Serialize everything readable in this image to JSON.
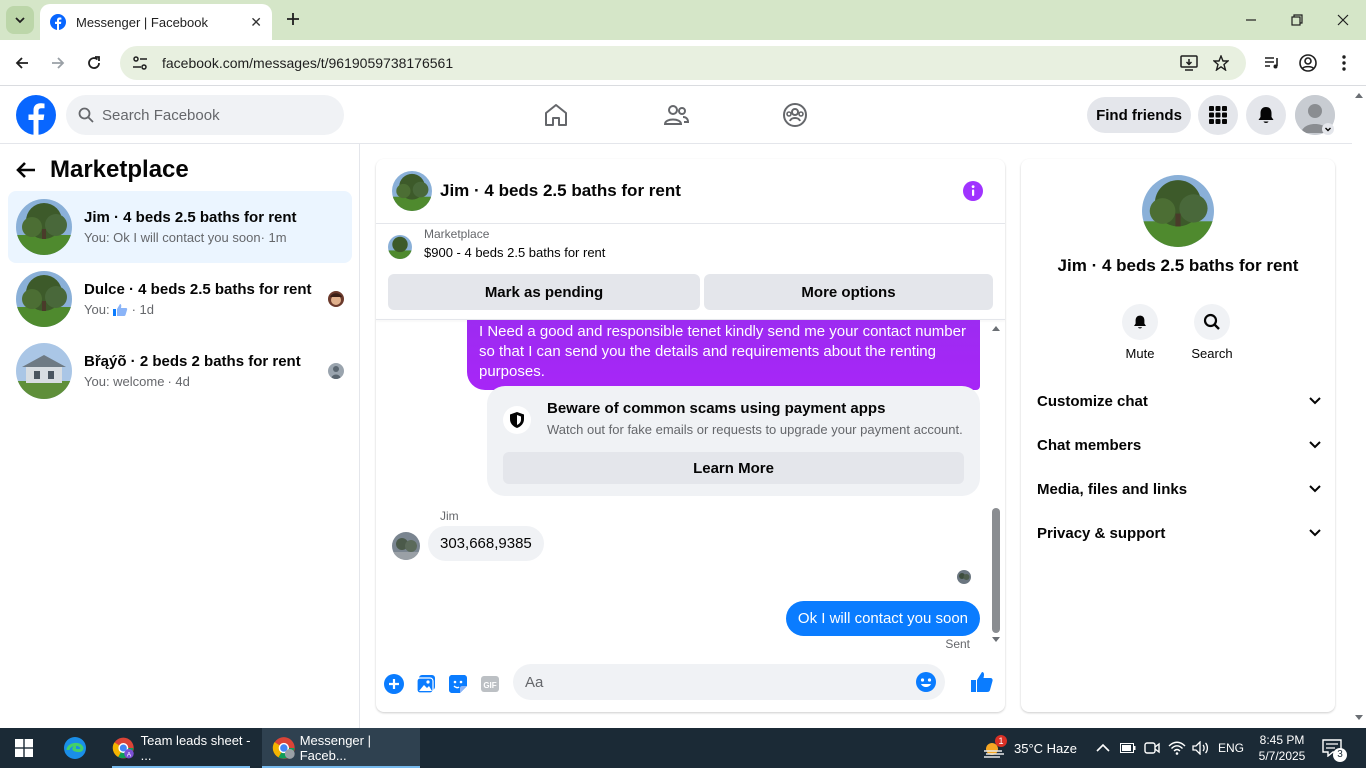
{
  "browser": {
    "tab_title": "Messenger | Facebook",
    "url": "facebook.com/messages/t/9619059738176561"
  },
  "fb": {
    "search_placeholder": "Search Facebook",
    "find_friends": "Find friends"
  },
  "left": {
    "title": "Marketplace",
    "conversations": [
      {
        "name": "Jim · 4 beds 2.5 baths for rent",
        "preview": "You: Ok I will contact you soon",
        "time": "· 1m",
        "active": true
      },
      {
        "name": "Dulce · 4 beds 2.5 baths for rent",
        "preview": "You: ",
        "time": "· 1d"
      },
      {
        "name": "Břąýõ · 2 beds 2 baths for rent",
        "preview": "You: welcome",
        "time": "· 4d"
      }
    ]
  },
  "chat": {
    "title": "Jim · 4 beds 2.5 baths for rent",
    "marketplace_label": "Marketplace",
    "listing": "$900 - 4 beds 2.5 baths for rent",
    "mark_pending": "Mark as pending",
    "more_options": "More options",
    "out_message": "I Need a good and responsible tenet kindly send me your contact number so that I can send you the details and requirements about the renting purposes.",
    "scam_title": "Beware of common scams using payment apps",
    "scam_text": "Watch out for fake emails or requests to upgrade your payment account.",
    "learn_more": "Learn More",
    "sender": "Jim",
    "in_message": "303,668,9385",
    "last_message": "Ok I will contact you soon",
    "sent_status": "Sent",
    "composer_placeholder": "Aa"
  },
  "right": {
    "name": "Jim · 4 beds 2.5 baths for rent",
    "mute": "Mute",
    "search": "Search",
    "sections": [
      "Customize chat",
      "Chat members",
      "Media, files and links",
      "Privacy & support"
    ]
  },
  "taskbar": {
    "app1": "Team leads sheet - ...",
    "app2": "Messenger | Faceb...",
    "weather": "35°C  Haze",
    "lang": "ENG",
    "time": "8:45 PM",
    "date": "5/7/2025",
    "notif_badge": "3",
    "weather_badge": "1"
  },
  "colors": {
    "fb_blue": "#0866ff",
    "messenger_purple": "#a033ff",
    "bubble_blue": "#0a7cff",
    "chrome_tab": "#d5e6c8"
  }
}
